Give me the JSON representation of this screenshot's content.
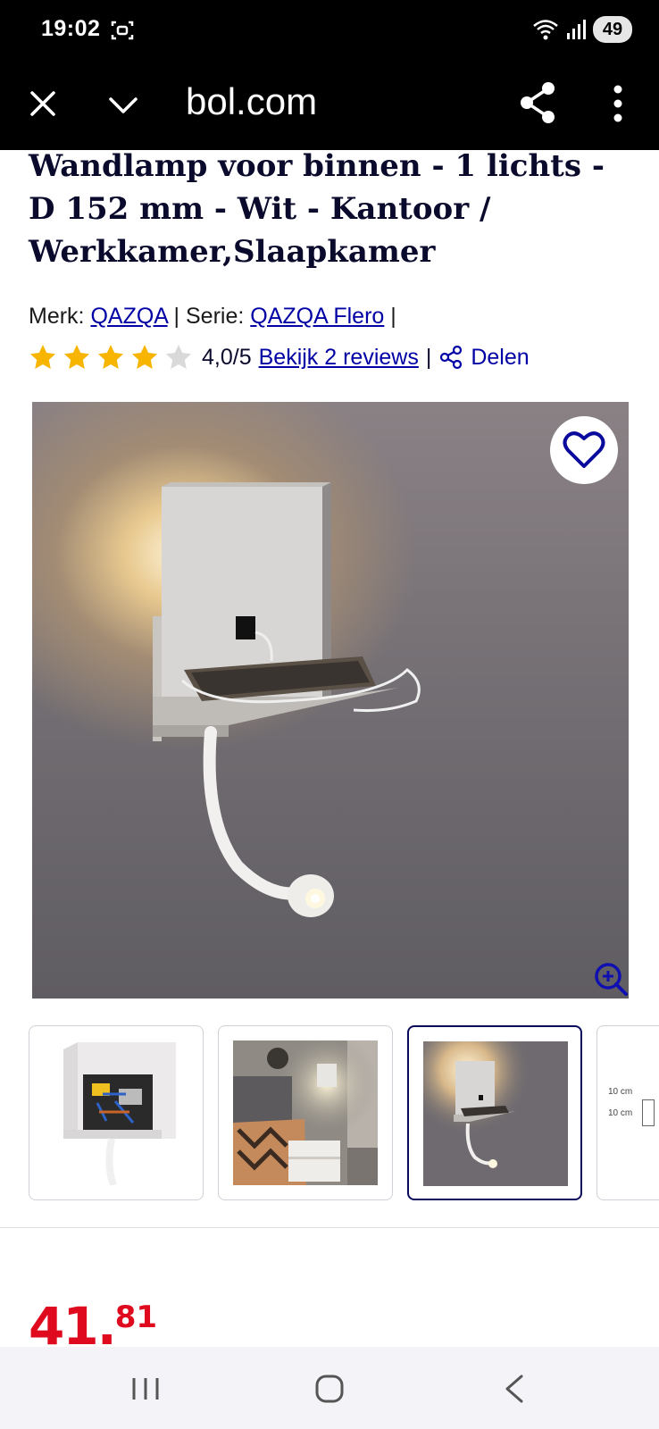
{
  "status_bar": {
    "time": "19:02",
    "battery": "49",
    "icons": [
      "screen-record-icon",
      "wifi-icon",
      "signal-icon"
    ]
  },
  "browser": {
    "url": "bol.com",
    "icons": [
      "close-icon",
      "chevron-down-icon",
      "share-icon",
      "more-vert-icon"
    ]
  },
  "product": {
    "title": "Wandlamp voor binnen - 1 lichts - D 152 mm - Wit - Kantoor / Werkkamer,Slaapkamer",
    "merk_label": "Merk:",
    "merk_value": "QAZQA",
    "separator": "|",
    "serie_label": "Serie:",
    "serie_value": "QAZQA Flero",
    "rating_value": 4,
    "rating_max": 5,
    "rating_text": "4,0/5",
    "reviews_link": "Bekijk 2 reviews",
    "share_label": "Delen"
  },
  "thumbnails": [
    "thumbnail-wiring",
    "thumbnail-bedroom",
    "thumbnail-lamp",
    "thumbnail-dimensions"
  ],
  "thumbnail_dimension_labels": [
    "10 cm",
    "10 cm"
  ],
  "price": {
    "whole": "41",
    "decimal": "81"
  },
  "colors": {
    "link": "#0000a4",
    "price": "#e00a1e",
    "star": "#f7b500",
    "title": "#0a0a2c"
  }
}
